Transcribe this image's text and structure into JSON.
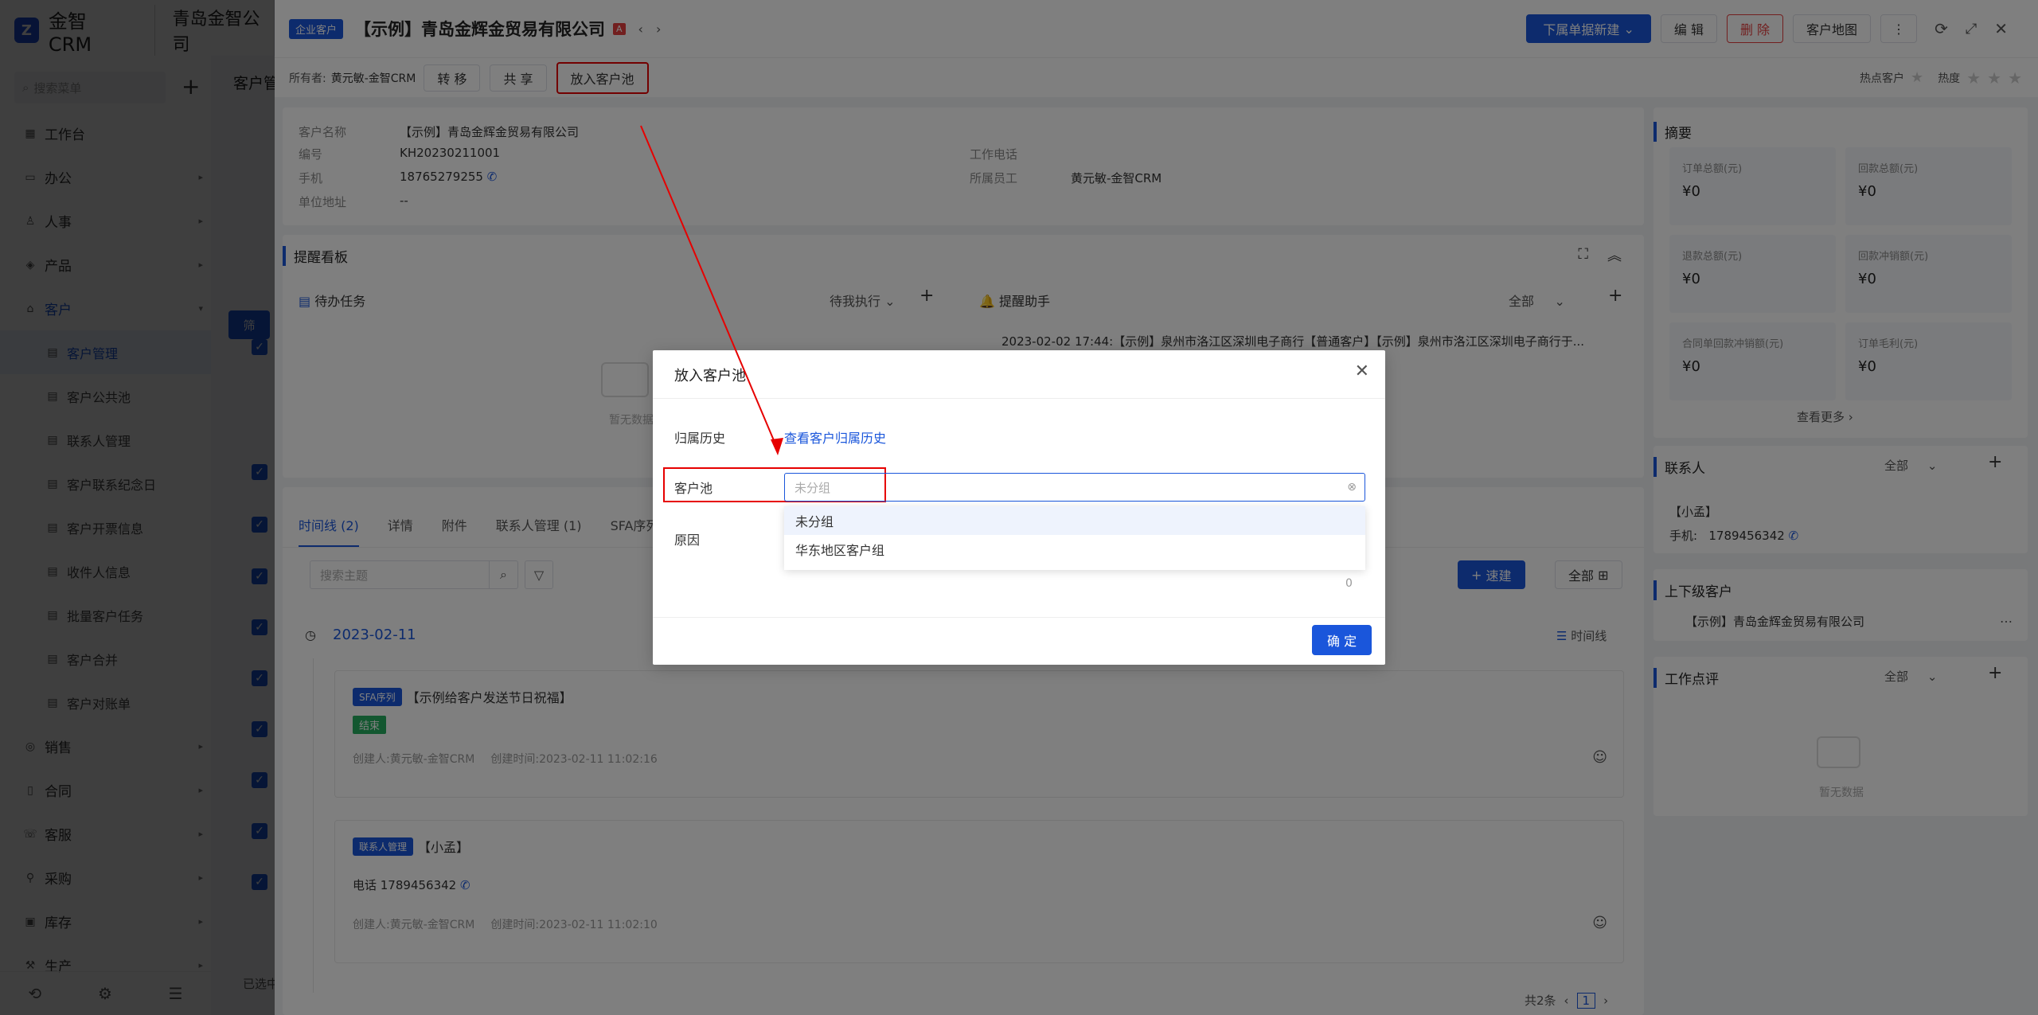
{
  "app": {
    "logo_text": "金智CRM",
    "company": "青岛金智公司",
    "search_placeholder": "搜索菜单"
  },
  "sidebar": {
    "items": [
      {
        "label": "工作台",
        "icon": "dashboard-icon"
      },
      {
        "label": "办公",
        "icon": "office-icon"
      },
      {
        "label": "人事",
        "icon": "people-icon"
      },
      {
        "label": "产品",
        "icon": "product-icon"
      },
      {
        "label": "客户",
        "icon": "customer-icon"
      },
      {
        "label": "客户管理",
        "icon": "list-icon"
      },
      {
        "label": "客户公共池",
        "icon": "list-icon"
      },
      {
        "label": "联系人管理",
        "icon": "list-icon"
      },
      {
        "label": "客户联系纪念日",
        "icon": "list-icon"
      },
      {
        "label": "客户开票信息",
        "icon": "list-icon"
      },
      {
        "label": "收件人信息",
        "icon": "list-icon"
      },
      {
        "label": "批量客户任务",
        "icon": "list-icon"
      },
      {
        "label": "客户合并",
        "icon": "list-icon"
      },
      {
        "label": "客户对账单",
        "icon": "list-icon"
      },
      {
        "label": "销售",
        "icon": "sales-icon"
      },
      {
        "label": "合同",
        "icon": "contract-icon"
      },
      {
        "label": "客服",
        "icon": "service-icon"
      },
      {
        "label": "采购",
        "icon": "purchase-icon"
      },
      {
        "label": "库存",
        "icon": "inventory-icon"
      },
      {
        "label": "生产",
        "icon": "production-icon"
      }
    ]
  },
  "background": {
    "title": "客户管",
    "bottom_text": "已选中"
  },
  "drawer": {
    "tag": "企业客户",
    "title": "【示例】青岛金辉金贸易有限公司",
    "actions": {
      "new_sub": "下属单据新建",
      "edit": "编 辑",
      "delete": "删 除",
      "map": "客户地图"
    },
    "owner_label": "所有者:",
    "owner": "黄元敏-金智CRM",
    "transfer": "转 移",
    "share": "共 享",
    "put_pool": "放入客户池",
    "hot_label": "热点客户",
    "heat_label": "热度",
    "info": {
      "name_label": "客户名称",
      "name": "【示例】青岛金辉金贸易有限公司",
      "code_label": "编号",
      "code": "KH20230211001",
      "phone_label": "手机",
      "phone": "18765279255",
      "address_label": "单位地址",
      "address": "--",
      "work_phone_label": "工作电话",
      "staff_label": "所属员工",
      "staff": "黄元敏-金智CRM"
    },
    "reminder": {
      "title": "提醒看板",
      "todo": "待办任务",
      "todo_filter": "待我执行",
      "assistant": "提醒助手",
      "assistant_filter": "全部",
      "notice": "2023-02-02 17:44:【示例】泉州市洛江区深圳电子商行【普通客户】【示例】泉州市洛江区深圳电子商行于...",
      "empty": "暂无数据"
    },
    "tabs": [
      "时间线 (2)",
      "详情",
      "附件",
      "联系人管理 (1)",
      "SFA序列"
    ],
    "search_placeholder": "搜索主题",
    "quick_new": "速建",
    "all": "全部",
    "timeline": {
      "date": "2023-02-11",
      "view": "时间线",
      "items": [
        {
          "tag": "SFA序列",
          "title": "【示例给客户发送节日祝福】",
          "status": "结束",
          "creator": "创建人:黄元敏-金智CRM",
          "time": "创建时间:2023-02-11 11:02:16"
        },
        {
          "tag": "联系人管理",
          "title": "【小孟】",
          "phone": "电话 1789456342",
          "creator": "创建人:黄元敏-金智CRM",
          "time": "创建时间:2023-02-11 11:02:10"
        }
      ]
    },
    "pagination": {
      "total": "共2条",
      "page": "1"
    },
    "summary": {
      "title": "摘要",
      "cells": [
        {
          "label": "订单总额(元)",
          "value": "¥0"
        },
        {
          "label": "回款总额(元)",
          "value": "¥0"
        },
        {
          "label": "退款总额(元)",
          "value": "¥0"
        },
        {
          "label": "回款冲销额(元)",
          "value": "¥0"
        },
        {
          "label": "合同单回款冲销额(元)",
          "value": "¥0"
        },
        {
          "label": "订单毛利(元)",
          "value": "¥0"
        }
      ],
      "more": "查看更多"
    },
    "contacts": {
      "title": "联系人",
      "filter": "全部",
      "name": "【小孟】",
      "phone_label": "手机:",
      "phone": "1789456342"
    },
    "parent": {
      "title": "上下级客户",
      "name": "【示例】青岛金辉金贸易有限公司"
    },
    "review": {
      "title": "工作点评",
      "filter": "全部",
      "empty": "暂无数据"
    }
  },
  "modal": {
    "title": "放入客户池",
    "history_label": "归属历史",
    "history_link": "查看客户归属历史",
    "pool_label": "客户池",
    "pool_placeholder": "未分组",
    "reason_label": "原因",
    "count": "0",
    "confirm": "确 定",
    "options": [
      "未分组",
      "华东地区客户组"
    ]
  }
}
